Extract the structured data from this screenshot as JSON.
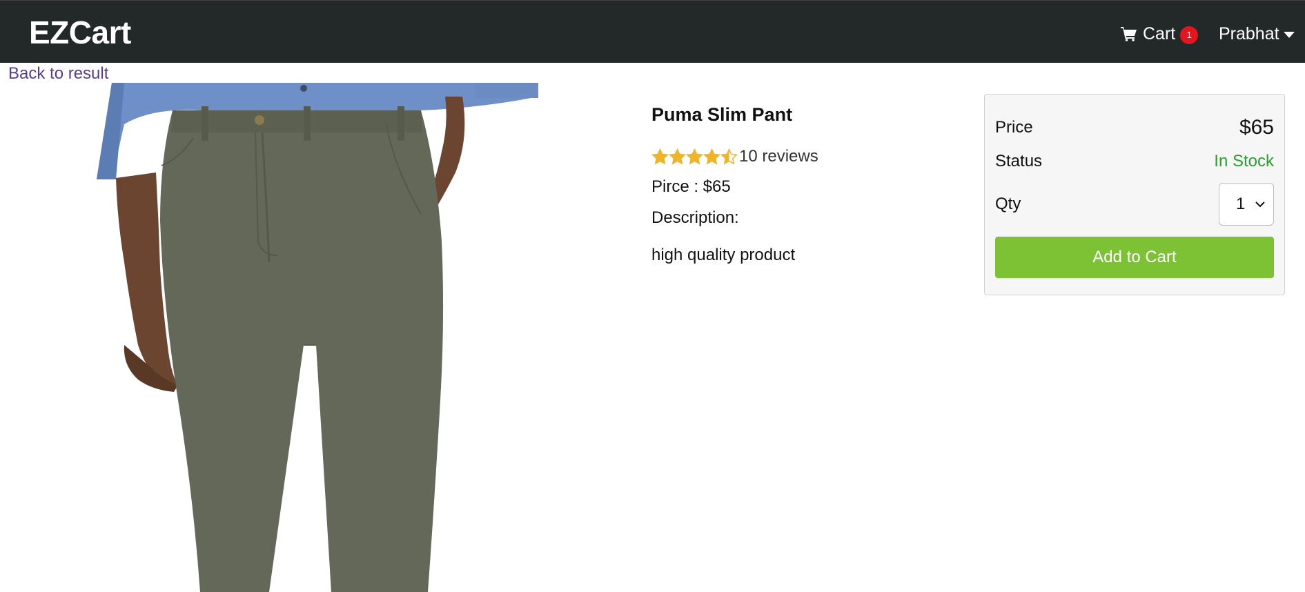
{
  "header": {
    "brand": "EZCart",
    "cart_label": "Cart",
    "cart_count": "1",
    "user_name": "Prabhat"
  },
  "back_link": "Back to result",
  "product": {
    "name": "Puma Slim Pant",
    "rating": 4.5,
    "reviews_text": "10 reviews",
    "price_line": "Pirce : $65",
    "description_label": "Description:",
    "description": "high quality product"
  },
  "purchase": {
    "price_label": "Price",
    "price_value": "$65",
    "status_label": "Status",
    "status_value": "In Stock",
    "qty_label": "Qty",
    "qty_value": "1",
    "add_button": "Add to Cart"
  },
  "colors": {
    "header_bg": "#232829",
    "badge": "#e3151f",
    "link": "#563d8f",
    "star": "#f0b429",
    "in_stock": "#28a02b",
    "button": "#7dc234"
  },
  "icons": {
    "cart": "cart-icon",
    "user_dropdown": "caret-down-icon",
    "qty_dropdown": "chevron-down-icon",
    "rating": "star-icon"
  }
}
